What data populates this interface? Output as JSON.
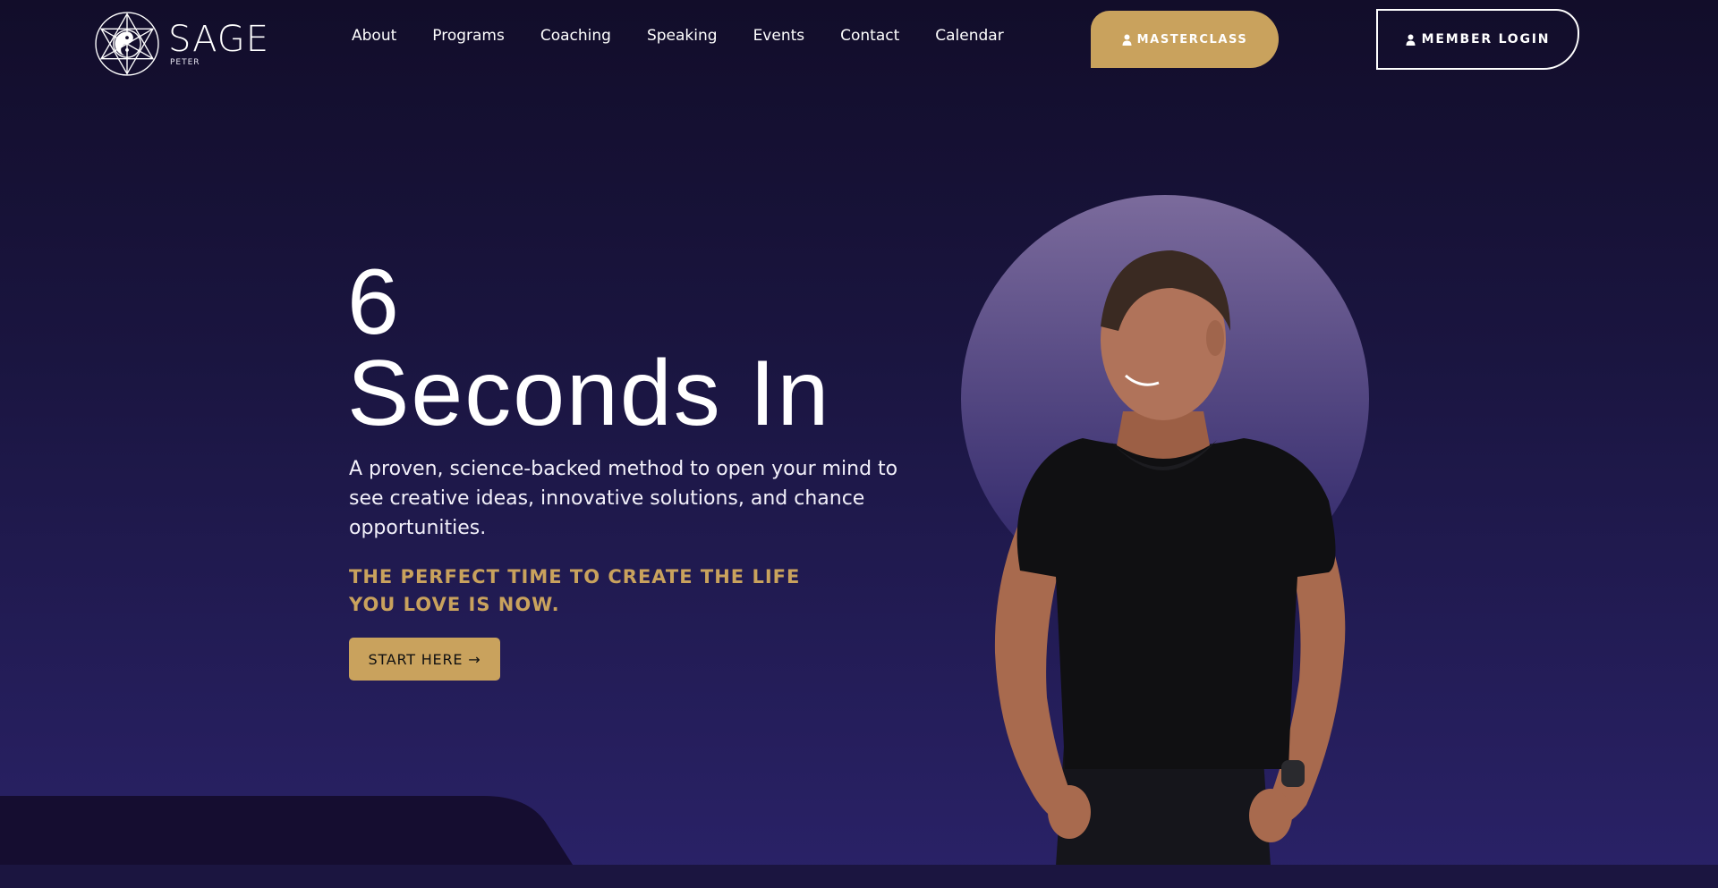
{
  "brand": {
    "name": "SAGE",
    "subname": "PETER"
  },
  "nav": {
    "items": [
      {
        "label": "About"
      },
      {
        "label": "Programs"
      },
      {
        "label": "Coaching"
      },
      {
        "label": "Speaking"
      },
      {
        "label": "Events"
      },
      {
        "label": "Contact"
      },
      {
        "label": "Calendar"
      }
    ]
  },
  "header_buttons": {
    "masterclass": "MASTERCLASS",
    "member_login": "MEMBER LOGIN",
    "icon": "user-icon"
  },
  "hero": {
    "title_line1": "6",
    "title_line2": "Seconds In",
    "description": "A proven, science-backed method to open your mind to see creative ideas, innovative solutions, and chance opportunities.",
    "tagline": "THE PERFECT TIME TO CREATE THE LIFE YOU LOVE IS NOW.",
    "cta_label": "START HERE",
    "cta_icon": "arrow-right-icon"
  },
  "colors": {
    "accent": "#c9a25d",
    "background_top": "#120d2a",
    "background_bottom": "#2a2268",
    "circle": "#7b6b9c"
  }
}
